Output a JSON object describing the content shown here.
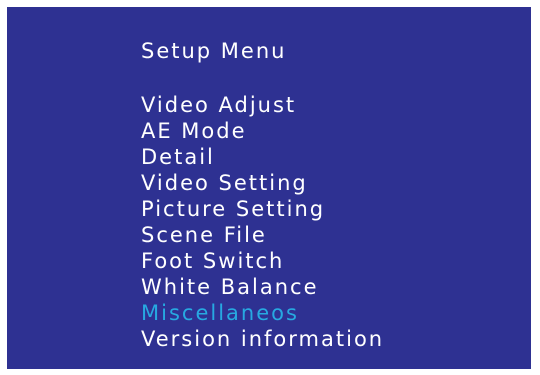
{
  "menu": {
    "title": "Setup Menu",
    "selected_index": 8,
    "selected_color": "#27a9e1",
    "background_color": "#2e3192",
    "items": [
      {
        "label": "Video Adjust"
      },
      {
        "label": "AE Mode"
      },
      {
        "label": "Detail"
      },
      {
        "label": "Video Setting"
      },
      {
        "label": "Picture Setting"
      },
      {
        "label": "Scene File"
      },
      {
        "label": "Foot Switch"
      },
      {
        "label": "White Balance"
      },
      {
        "label": "Miscellaneos"
      },
      {
        "label": "Version information"
      }
    ]
  }
}
